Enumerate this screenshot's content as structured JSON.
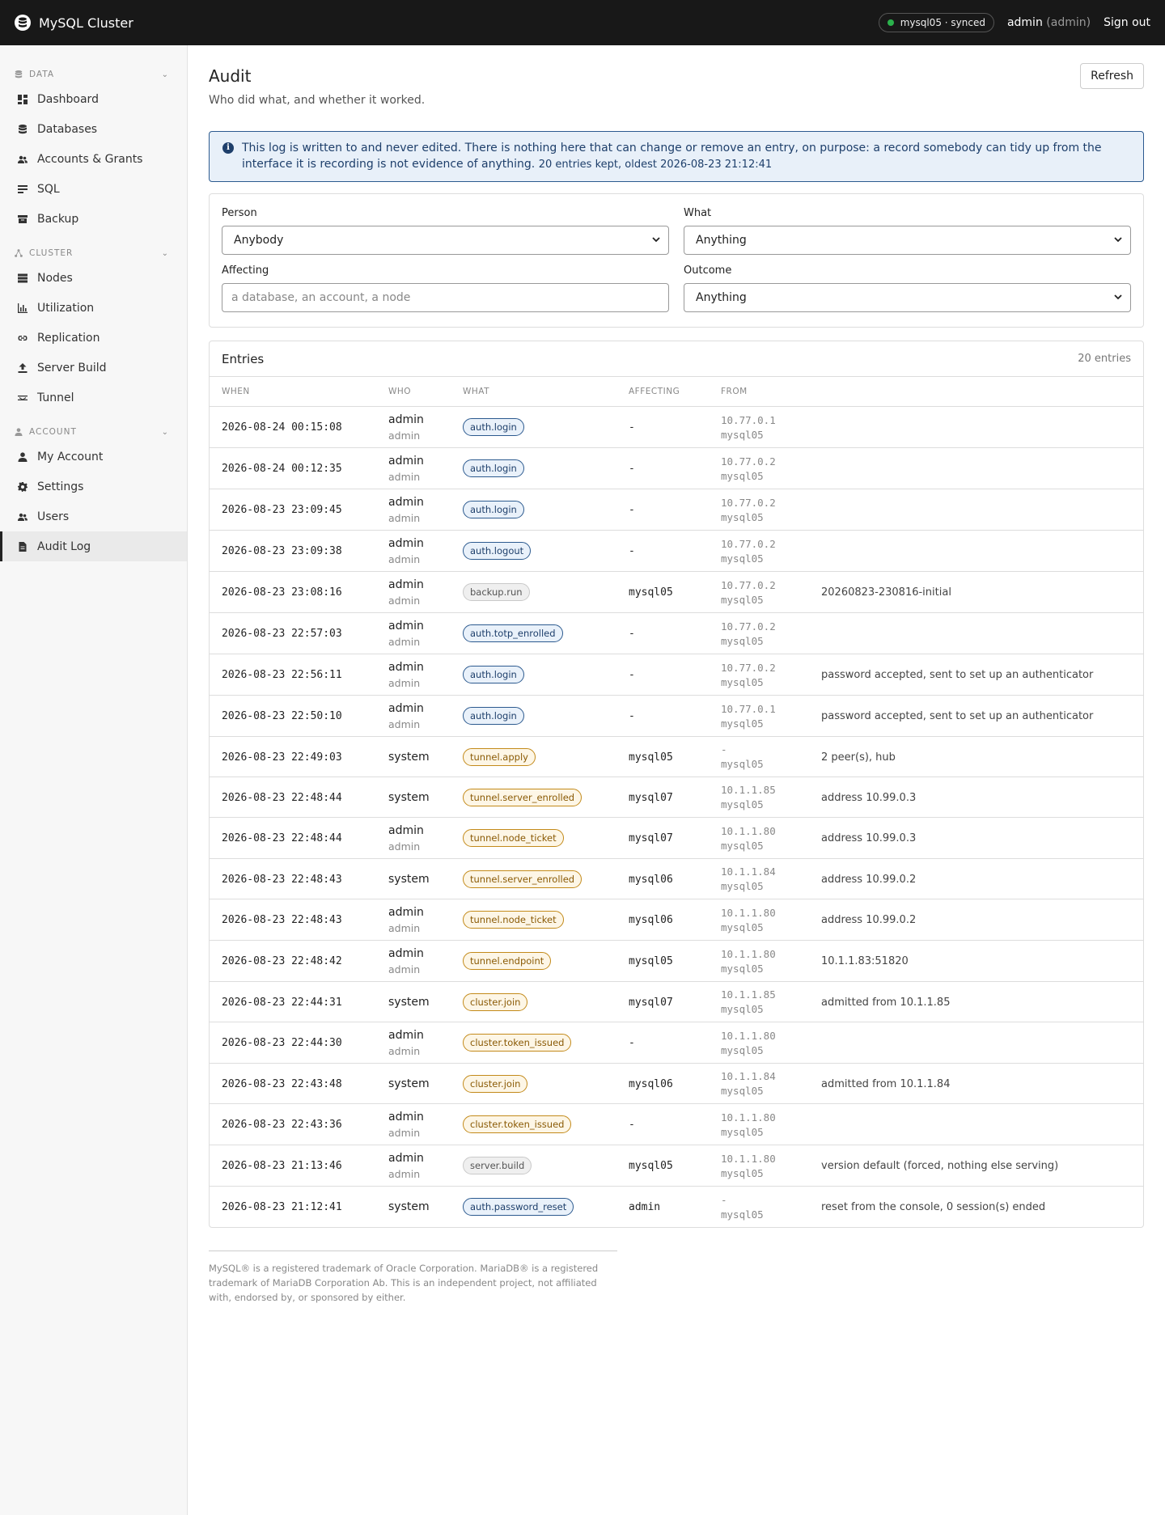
{
  "app": {
    "title": "MySQL Cluster",
    "sync_status": "mysql05 · synced",
    "sync_color": "#2bb24c",
    "user": "admin",
    "user_role": "(admin)",
    "sign_out": "Sign out"
  },
  "sidebar": {
    "sections": [
      {
        "title": "DATA",
        "icon": "database-icon",
        "items": [
          {
            "label": "Dashboard",
            "icon": "dashboard-icon",
            "name": "sidebar-item-dashboard"
          },
          {
            "label": "Databases",
            "icon": "database-icon",
            "name": "sidebar-item-databases"
          },
          {
            "label": "Accounts & Grants",
            "icon": "users-icon",
            "name": "sidebar-item-accounts-grants"
          },
          {
            "label": "SQL",
            "icon": "sql-icon",
            "name": "sidebar-item-sql"
          },
          {
            "label": "Backup",
            "icon": "archive-icon",
            "name": "sidebar-item-backup"
          }
        ]
      },
      {
        "title": "CLUSTER",
        "icon": "cluster-icon",
        "items": [
          {
            "label": "Nodes",
            "icon": "server-icon",
            "name": "sidebar-item-nodes"
          },
          {
            "label": "Utilization",
            "icon": "bar-chart-icon",
            "name": "sidebar-item-utilization"
          },
          {
            "label": "Replication",
            "icon": "link-icon",
            "name": "sidebar-item-replication"
          },
          {
            "label": "Server Build",
            "icon": "upload-icon",
            "name": "sidebar-item-server-build"
          },
          {
            "label": "Tunnel",
            "icon": "tunnel-icon",
            "name": "sidebar-item-tunnel"
          }
        ]
      },
      {
        "title": "ACCOUNT",
        "icon": "person-icon",
        "items": [
          {
            "label": "My Account",
            "icon": "person-icon",
            "name": "sidebar-item-my-account"
          },
          {
            "label": "Settings",
            "icon": "gear-icon",
            "name": "sidebar-item-settings"
          },
          {
            "label": "Users",
            "icon": "users-icon",
            "name": "sidebar-item-users"
          },
          {
            "label": "Audit Log",
            "icon": "file-icon",
            "name": "sidebar-item-audit-log",
            "active": true
          }
        ]
      }
    ]
  },
  "page": {
    "title": "Audit",
    "subtitle": "Who did what, and whether it worked.",
    "refresh_label": "Refresh"
  },
  "notice": {
    "text": "This log is written to and never edited. There is nothing here that can change or remove an entry, on purpose: a record somebody can tidy up from the interface it is recording is not evidence of anything.",
    "meta": "20 entries kept, oldest 2026-08-23 21:12:41"
  },
  "filters": {
    "person_label": "Person",
    "person_value": "Anybody",
    "what_label": "What",
    "what_value": "Anything",
    "affecting_label": "Affecting",
    "affecting_placeholder": "a database, an account, a node",
    "outcome_label": "Outcome",
    "outcome_value": "Anything"
  },
  "entries": {
    "title": "Entries",
    "count": "20 entries",
    "columns": {
      "when": "WHEN",
      "who": "WHO",
      "what": "WHAT",
      "affecting": "AFFECTING",
      "from": "FROM"
    },
    "rows": [
      {
        "when": "2026-08-24 00:15:08",
        "who": "admin",
        "role": "admin",
        "what": "auth.login",
        "kind": "blue",
        "affecting": "-",
        "ip": "10.77.0.1",
        "host": "mysql05",
        "note": ""
      },
      {
        "when": "2026-08-24 00:12:35",
        "who": "admin",
        "role": "admin",
        "what": "auth.login",
        "kind": "blue",
        "affecting": "-",
        "ip": "10.77.0.2",
        "host": "mysql05",
        "note": ""
      },
      {
        "when": "2026-08-23 23:09:45",
        "who": "admin",
        "role": "admin",
        "what": "auth.login",
        "kind": "blue",
        "affecting": "-",
        "ip": "10.77.0.2",
        "host": "mysql05",
        "note": ""
      },
      {
        "when": "2026-08-23 23:09:38",
        "who": "admin",
        "role": "admin",
        "what": "auth.logout",
        "kind": "blue",
        "affecting": "-",
        "ip": "10.77.0.2",
        "host": "mysql05",
        "note": ""
      },
      {
        "when": "2026-08-23 23:08:16",
        "who": "admin",
        "role": "admin",
        "what": "backup.run",
        "kind": "gray",
        "affecting": "mysql05",
        "ip": "10.77.0.2",
        "host": "mysql05",
        "note": "20260823-230816-initial"
      },
      {
        "when": "2026-08-23 22:57:03",
        "who": "admin",
        "role": "admin",
        "what": "auth.totp_enrolled",
        "kind": "blue",
        "affecting": "-",
        "ip": "10.77.0.2",
        "host": "mysql05",
        "note": ""
      },
      {
        "when": "2026-08-23 22:56:11",
        "who": "admin",
        "role": "admin",
        "what": "auth.login",
        "kind": "blue",
        "affecting": "-",
        "ip": "10.77.0.2",
        "host": "mysql05",
        "note": "password accepted, sent to set up an authenticator"
      },
      {
        "when": "2026-08-23 22:50:10",
        "who": "admin",
        "role": "admin",
        "what": "auth.login",
        "kind": "blue",
        "affecting": "-",
        "ip": "10.77.0.1",
        "host": "mysql05",
        "note": "password accepted, sent to set up an authenticator"
      },
      {
        "when": "2026-08-23 22:49:03",
        "who": "system",
        "role": "",
        "what": "tunnel.apply",
        "kind": "orange",
        "affecting": "mysql05",
        "ip": "-",
        "host": "mysql05",
        "note": "2 peer(s), hub"
      },
      {
        "when": "2026-08-23 22:48:44",
        "who": "system",
        "role": "",
        "what": "tunnel.server_enrolled",
        "kind": "orange",
        "affecting": "mysql07",
        "ip": "10.1.1.85",
        "host": "mysql05",
        "note": "address 10.99.0.3"
      },
      {
        "when": "2026-08-23 22:48:44",
        "who": "admin",
        "role": "admin",
        "what": "tunnel.node_ticket",
        "kind": "orange",
        "affecting": "mysql07",
        "ip": "10.1.1.80",
        "host": "mysql05",
        "note": "address 10.99.0.3"
      },
      {
        "when": "2026-08-23 22:48:43",
        "who": "system",
        "role": "",
        "what": "tunnel.server_enrolled",
        "kind": "orange",
        "affecting": "mysql06",
        "ip": "10.1.1.84",
        "host": "mysql05",
        "note": "address 10.99.0.2"
      },
      {
        "when": "2026-08-23 22:48:43",
        "who": "admin",
        "role": "admin",
        "what": "tunnel.node_ticket",
        "kind": "orange",
        "affecting": "mysql06",
        "ip": "10.1.1.80",
        "host": "mysql05",
        "note": "address 10.99.0.2"
      },
      {
        "when": "2026-08-23 22:48:42",
        "who": "admin",
        "role": "admin",
        "what": "tunnel.endpoint",
        "kind": "orange",
        "affecting": "mysql05",
        "ip": "10.1.1.80",
        "host": "mysql05",
        "note": "10.1.1.83:51820"
      },
      {
        "when": "2026-08-23 22:44:31",
        "who": "system",
        "role": "",
        "what": "cluster.join",
        "kind": "orange",
        "affecting": "mysql07",
        "ip": "10.1.1.85",
        "host": "mysql05",
        "note": "admitted from 10.1.1.85"
      },
      {
        "when": "2026-08-23 22:44:30",
        "who": "admin",
        "role": "admin",
        "what": "cluster.token_issued",
        "kind": "orange",
        "affecting": "-",
        "ip": "10.1.1.80",
        "host": "mysql05",
        "note": ""
      },
      {
        "when": "2026-08-23 22:43:48",
        "who": "system",
        "role": "",
        "what": "cluster.join",
        "kind": "orange",
        "affecting": "mysql06",
        "ip": "10.1.1.84",
        "host": "mysql05",
        "note": "admitted from 10.1.1.84"
      },
      {
        "when": "2026-08-23 22:43:36",
        "who": "admin",
        "role": "admin",
        "what": "cluster.token_issued",
        "kind": "orange",
        "affecting": "-",
        "ip": "10.1.1.80",
        "host": "mysql05",
        "note": ""
      },
      {
        "when": "2026-08-23 21:13:46",
        "who": "admin",
        "role": "admin",
        "what": "server.build",
        "kind": "gray",
        "affecting": "mysql05",
        "ip": "10.1.1.80",
        "host": "mysql05",
        "note": "version default (forced, nothing else serving)"
      },
      {
        "when": "2026-08-23 21:12:41",
        "who": "system",
        "role": "",
        "what": "auth.password_reset",
        "kind": "blue",
        "affecting": "admin",
        "ip": "-",
        "host": "mysql05",
        "note": "reset from the console, 0 session(s) ended"
      }
    ]
  },
  "footer": {
    "text": "MySQL® is a registered trademark of Oracle Corporation. MariaDB® is a registered trademark of MariaDB Corporation Ab. This is an independent project, not affiliated with, endorsed by, or sponsored by either."
  }
}
